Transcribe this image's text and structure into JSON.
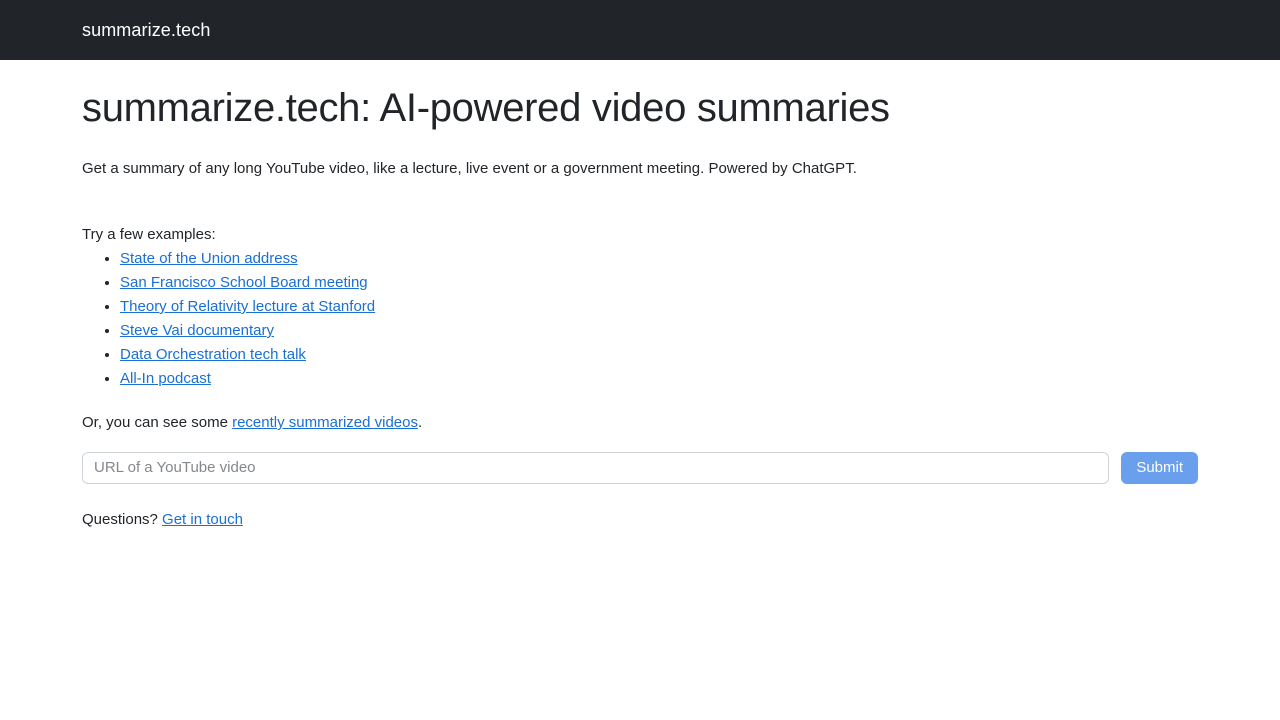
{
  "navbar": {
    "brand": "summarize.tech"
  },
  "main": {
    "title": "summarize.tech: AI-powered video summaries",
    "lead": "Get a summary of any long YouTube video, like a lecture, live event or a government meeting. Powered by ChatGPT.",
    "examples_intro": "Try a few examples:",
    "examples": [
      {
        "label": "State of the Union address"
      },
      {
        "label": "San Francisco School Board meeting"
      },
      {
        "label": "Theory of Relativity lecture at Stanford"
      },
      {
        "label": "Steve Vai documentary"
      },
      {
        "label": "Data Orchestration tech talk"
      },
      {
        "label": "All-In podcast"
      }
    ],
    "recent": {
      "prefix": "Or, you can see some ",
      "link_label": "recently summarized videos",
      "suffix": "."
    },
    "form": {
      "placeholder": "URL of a YouTube video",
      "value": "",
      "submit_label": "Submit"
    },
    "questions": {
      "prefix": "Questions? ",
      "link_label": "Get in touch"
    }
  },
  "colors": {
    "navbar_background": "#212529",
    "text": "#212529",
    "link": "#1a6fd4",
    "button_background": "#6a9fee",
    "input_border": "#ced4da",
    "placeholder": "#84888c",
    "page_background": "#ffffff"
  }
}
